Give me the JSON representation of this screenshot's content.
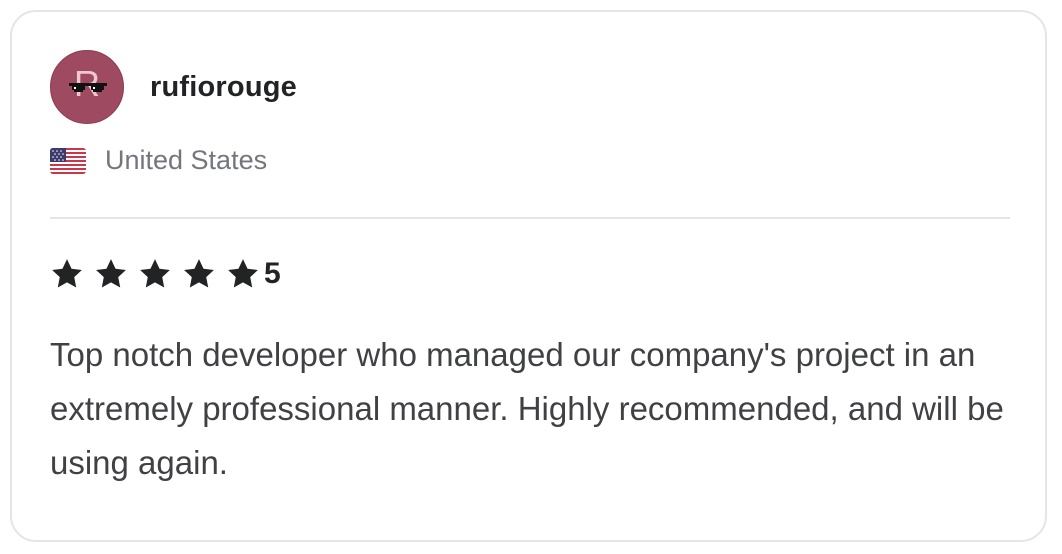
{
  "reviewer": {
    "avatar_initial": "R",
    "username": "rufiorouge",
    "country": "United States",
    "flag_icon": "us-flag-icon"
  },
  "rating": {
    "value": "5",
    "stars": 5,
    "star_color": "#222325"
  },
  "review": {
    "text": "Top notch developer who managed our company's project in an extremely professional manner. Highly recommended, and will be using again."
  },
  "colors": {
    "avatar_bg": "#9e4a60",
    "text_primary": "#222325",
    "text_secondary": "#74767e",
    "body_text": "#404145",
    "border": "#e4e5e7"
  }
}
